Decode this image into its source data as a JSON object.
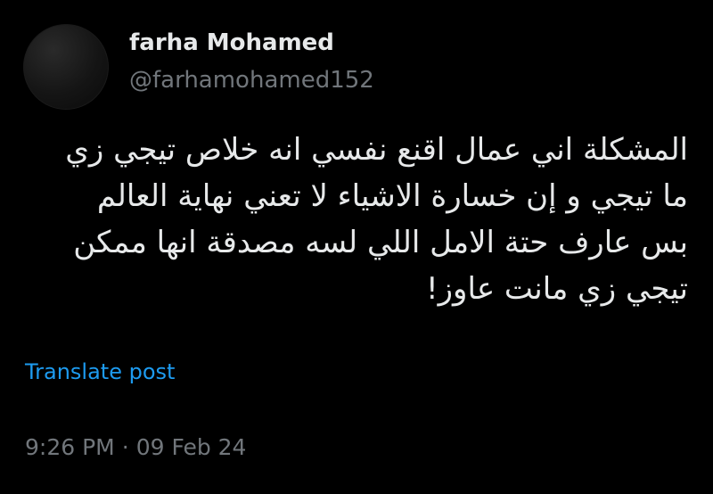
{
  "author": {
    "display_name": "farha Mohamed",
    "handle": "@farhamohamed152"
  },
  "post": {
    "lines": [
      "المشكلة اني عمال اقنع نفسي انه خلاص تيجي زي",
      "ما تيجي و إن خسارة الاشياء لا تعني نهاية العالم",
      "بس عارف حتة الامل اللي لسه مصدقة انها ممكن",
      "تيجي زي مانت عاوز!"
    ],
    "translate_label": "Translate post",
    "time": "9:26 PM",
    "separator": "·",
    "date": "09 Feb 24"
  },
  "colors": {
    "background": "#000000",
    "text": "#e7e9ea",
    "secondary": "#71767b",
    "link": "#1d9bf0"
  }
}
